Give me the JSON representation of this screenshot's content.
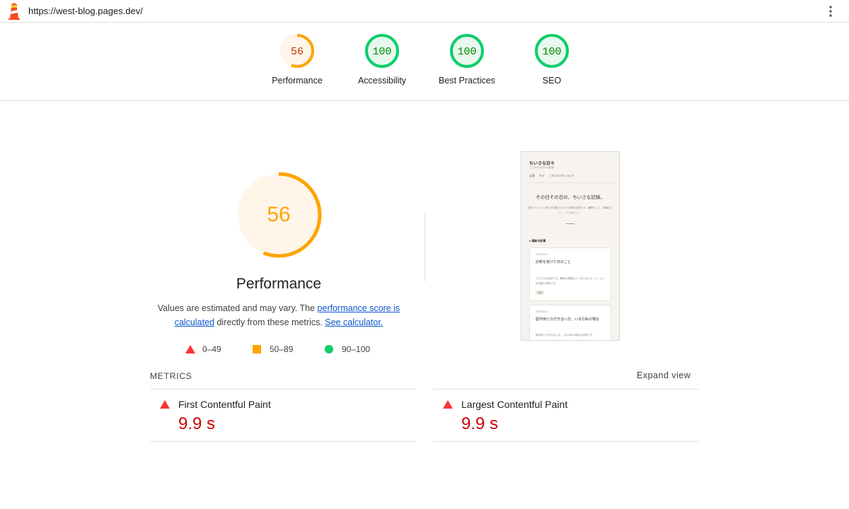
{
  "browser": {
    "url": "https://west-blog.pages.dev/",
    "logo_icon": "lighthouse-icon",
    "menu_icon": "more-vert-icon"
  },
  "categories": [
    {
      "label": "Performance",
      "score": "56",
      "fraction": 0.56,
      "status": "average"
    },
    {
      "label": "Accessibility",
      "score": "100",
      "fraction": 1.0,
      "status": "pass"
    },
    {
      "label": "Best Practices",
      "score": "100",
      "fraction": 1.0,
      "status": "pass"
    },
    {
      "label": "SEO",
      "score": "100",
      "fraction": 1.0,
      "status": "pass"
    }
  ],
  "performance": {
    "score": "56",
    "fraction": 0.56,
    "title": "Performance",
    "desc_pre": "Values are estimated and may vary. The ",
    "desc_link1": "performance score is calculated",
    "desc_mid": " directly from these metrics. ",
    "desc_link2": "See calculator."
  },
  "legend": [
    {
      "shape": "triangle",
      "range": "0–49"
    },
    {
      "shape": "square",
      "range": "50–89"
    },
    {
      "shape": "circle",
      "range": "90–100"
    }
  ],
  "metrics": {
    "header": "METRICS",
    "expand_label": "Expand view",
    "items": [
      {
        "title": "First Contentful Paint",
        "value": "9.9 s",
        "status": "fail"
      },
      {
        "title": "Largest Contentful Paint",
        "value": "9.9 s",
        "status": "fail"
      }
    ]
  },
  "thumbnail": {
    "site_title": "ちいさな日々",
    "site_subtitle": "ささやかな日々の記録",
    "nav": [
      "記事",
      "タグ",
      "このブログについて"
    ],
    "hero": "その日その日の、ちいさな記録。",
    "hero_desc": "日常でクスッと思わず記録されたその場の記録です。通院のこと、情報のこと、こころのこと。",
    "section": "● 最新の記事",
    "cards": [
      {
        "date": "2025.08.10",
        "title": "診断を受けた日のこと",
        "text": "ささやかな記録です。職場の理解はよくありません。ケニストは何度も説明です。",
        "tag": "通院"
      },
      {
        "date": "2025.08.04",
        "title": "副作用との付き合い方、いまの私の場合",
        "text": "副作用との付き合いは、いまの私の場合の説明です。",
        "tag": ""
      }
    ]
  },
  "colors": {
    "fail": "#ff3333",
    "fail_text": "#cc0000",
    "average": "#ffa400",
    "average_text": "#c33300",
    "average_bg": "#fff6e9",
    "pass": "#0cce6b",
    "pass_text": "#008800",
    "pass_bg": "#e8f8ef"
  }
}
